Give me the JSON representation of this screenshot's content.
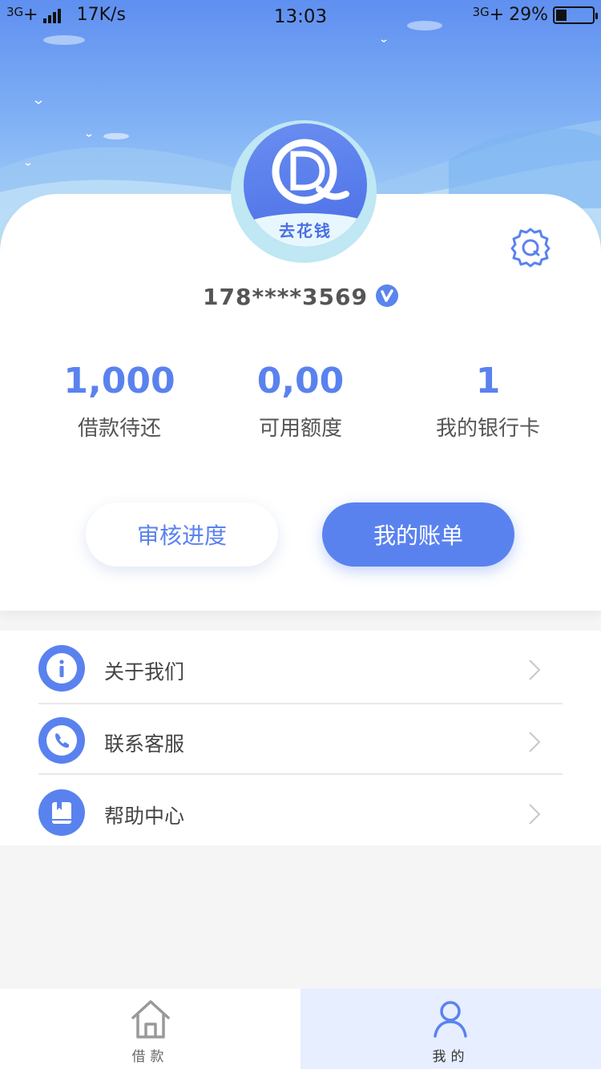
{
  "status_bar": {
    "network_left": "3G",
    "network_left_plus": "+",
    "speed": "17K/s",
    "time": "13:03",
    "network_right": "3G",
    "network_right_plus": "+",
    "battery_percent": "29%",
    "battery_level": 0.29
  },
  "brand": {
    "logo_letters": "DQ",
    "name": "去花钱"
  },
  "profile": {
    "phone": "178****3569",
    "verified_mark": "V"
  },
  "stats": [
    {
      "value": "1,000",
      "label": "借款待还"
    },
    {
      "value": "0,00",
      "label": "可用额度"
    },
    {
      "value": "1",
      "label": "我的银行卡"
    }
  ],
  "actions": {
    "progress_label": "审核进度",
    "bill_label": "我的账单"
  },
  "menu": [
    {
      "label": "关于我们",
      "icon": "info-icon"
    },
    {
      "label": "联系客服",
      "icon": "phone-icon"
    },
    {
      "label": "帮助中心",
      "icon": "book-icon"
    }
  ],
  "tabbar": {
    "loan": {
      "label": "借款",
      "icon": "home-icon"
    },
    "mine": {
      "label": "我的",
      "icon": "user-icon",
      "active": true
    }
  },
  "colors": {
    "accent": "#5a82ef",
    "active_tab_bg": "#e6eeff"
  }
}
